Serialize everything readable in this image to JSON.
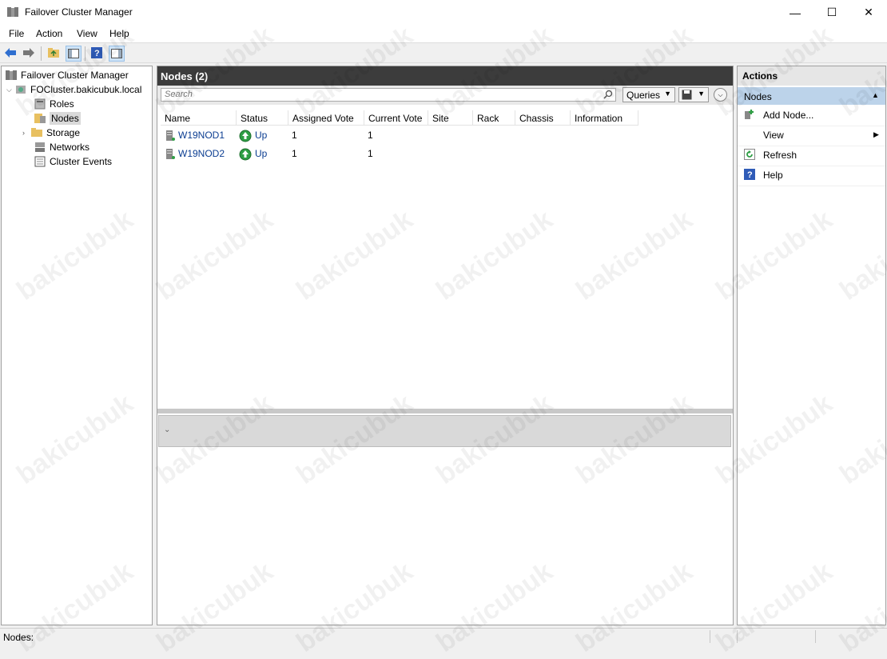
{
  "window": {
    "title": "Failover Cluster Manager",
    "minimize": "—",
    "maximize": "☐",
    "close": "✕"
  },
  "menu": [
    "File",
    "Action",
    "View",
    "Help"
  ],
  "tree": {
    "root": "Failover Cluster Manager",
    "cluster": "FOCluster.bakicubuk.local",
    "items": [
      "Roles",
      "Nodes",
      "Storage",
      "Networks",
      "Cluster Events"
    ]
  },
  "center": {
    "header": "Nodes (2)",
    "search_placeholder": "Search",
    "queries_label": "Queries",
    "columns": [
      "Name",
      "Status",
      "Assigned Vote",
      "Current Vote",
      "Site",
      "Rack",
      "Chassis",
      "Information"
    ],
    "rows": [
      {
        "name": "W19NOD1",
        "status": "Up",
        "assigned_vote": "1",
        "current_vote": "1"
      },
      {
        "name": "W19NOD2",
        "status": "Up",
        "assigned_vote": "1",
        "current_vote": "1"
      }
    ]
  },
  "actions": {
    "header": "Actions",
    "section": "Nodes",
    "items": [
      "Add Node...",
      "View",
      "Refresh",
      "Help"
    ]
  },
  "status_bar": "Nodes:",
  "watermark": "bakicubuk",
  "colors": {
    "title_dark": "#3c3c3c",
    "selection_blue": "#bcd3ea",
    "link_blue": "#0b3d91",
    "status_green": "#2e9e44"
  }
}
